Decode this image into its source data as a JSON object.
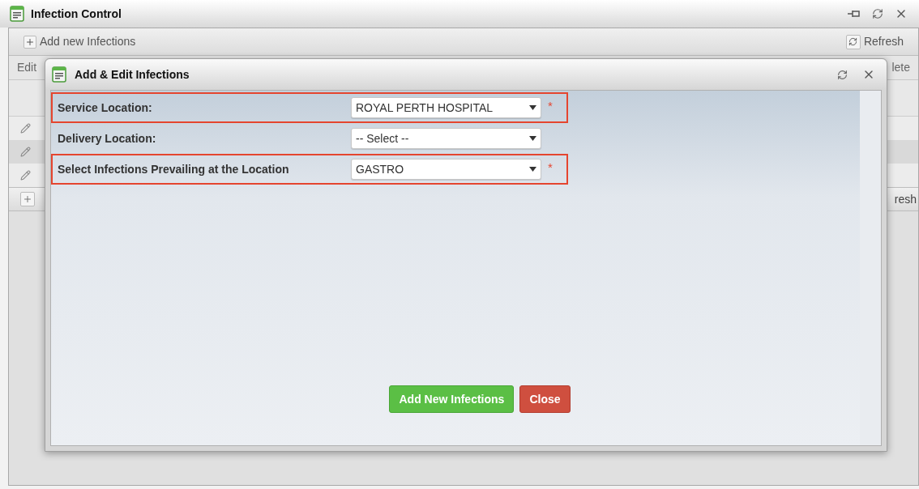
{
  "window": {
    "title": "Infection Control"
  },
  "toolbar": {
    "add_label": "Add new Infections",
    "refresh_label": "Refresh"
  },
  "grid": {
    "column_1": "Edit",
    "column_2": "lete",
    "rows": [
      {
        "editable": true
      },
      {
        "editable": true
      },
      {
        "editable": true
      }
    ]
  },
  "bottom_toolbar": {
    "refresh_label": "resh"
  },
  "dialog": {
    "title": "Add & Edit Infections",
    "fields": [
      {
        "label": "Service Location:",
        "value": "ROYAL PERTH HOSPITAL",
        "highlighted": true,
        "required_mark": "*"
      },
      {
        "label": "Delivery Location:",
        "value": "-- Select --",
        "highlighted": false
      },
      {
        "label": "Select Infections Prevailing at the Location",
        "value": "GASTRO",
        "highlighted": true,
        "required_mark": "*"
      }
    ],
    "buttons": [
      {
        "label": "Add New Infections",
        "kind": "primary"
      },
      {
        "label": "Close",
        "kind": "danger"
      }
    ]
  }
}
